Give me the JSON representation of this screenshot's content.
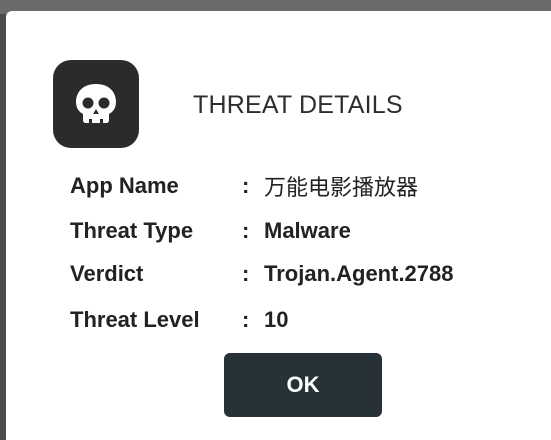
{
  "dialog": {
    "title": "THREAT DETAILS",
    "icon": "skull-icon",
    "rows": [
      {
        "label": "App Name",
        "colon": ":",
        "value": "万能电影播放器"
      },
      {
        "label": "Threat Type",
        "colon": ":",
        "value": "Malware"
      },
      {
        "label": "Verdict",
        "colon": ":",
        "value": "Trojan.Agent.2788"
      },
      {
        "label": "Threat Level",
        "colon": ":",
        "value": "10"
      }
    ],
    "ok_label": "OK"
  },
  "colors": {
    "icon_bg": "#2b2b2b",
    "button_bg": "#263238",
    "dialog_bg": "#ffffff"
  }
}
